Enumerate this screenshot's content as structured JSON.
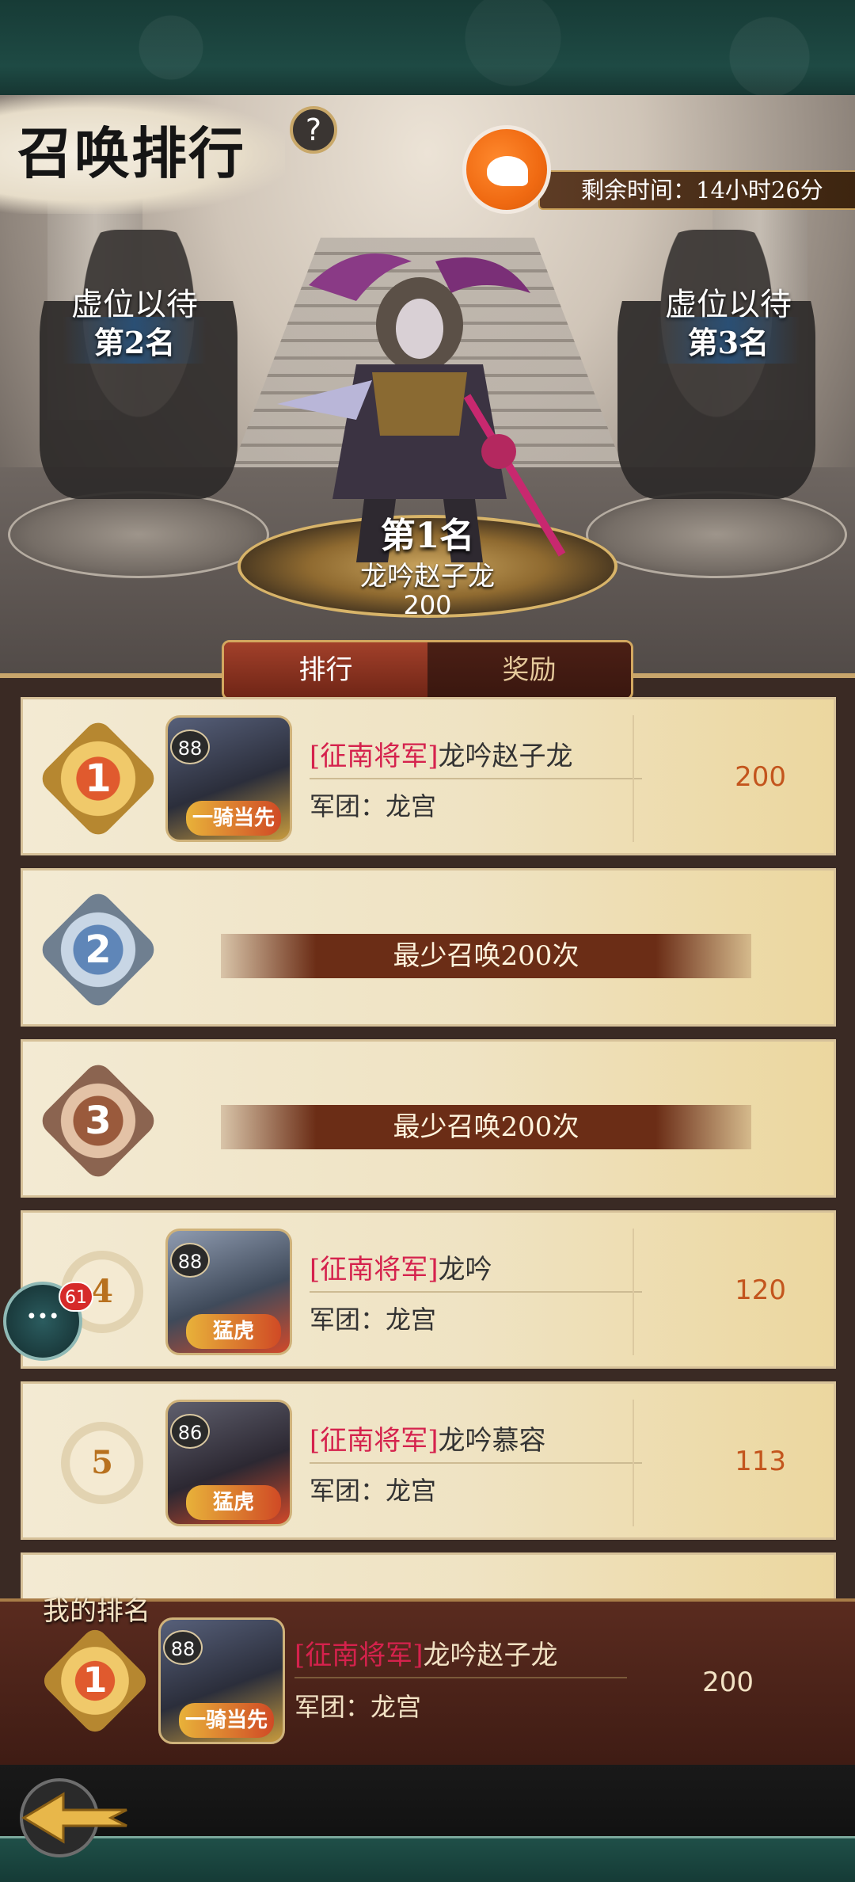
{
  "header": {
    "title": "召唤排行",
    "help": "?",
    "timer": "剩余时间：14小时26分"
  },
  "podium": {
    "second_label": "虚位以待",
    "second_rank": "第2名",
    "third_label": "虚位以待",
    "third_rank": "第3名",
    "first_rank": "第1名",
    "first_name": "龙吟赵子龙",
    "first_score": "200"
  },
  "tabs": [
    {
      "label": "排行"
    },
    {
      "label": "奖励"
    }
  ],
  "rows": [
    {
      "rank": "1",
      "level": "88",
      "title": "[征南将军]",
      "name": "龙吟赵子龙",
      "guild": "军团：龙宫",
      "score": "200",
      "tag": "一骑当先"
    },
    {
      "rank": "2",
      "requirement": "最少召唤200次"
    },
    {
      "rank": "3",
      "requirement": "最少召唤200次"
    },
    {
      "rank": "4",
      "level": "88",
      "title": "[征南将军]",
      "name": "龙吟",
      "guild": "军团：龙宫",
      "score": "120",
      "tag": "猛虎"
    },
    {
      "rank": "5",
      "level": "86",
      "title": "[征南将军]",
      "name": "龙吟慕容",
      "guild": "军团：龙宫",
      "score": "113",
      "tag": "猛虎"
    }
  ],
  "chat": {
    "badge": "61"
  },
  "my_rank": {
    "label": "我的排名",
    "rank": "1",
    "level": "88",
    "title": "[征南将军]",
    "name": "龙吟赵子龙",
    "guild": "军团：龙宫",
    "score": "200",
    "tag": "一骑当先"
  },
  "colors": {
    "title_red": "#d5224d",
    "score_orange": "#c3551d",
    "brand_orange": "#f06a12"
  }
}
